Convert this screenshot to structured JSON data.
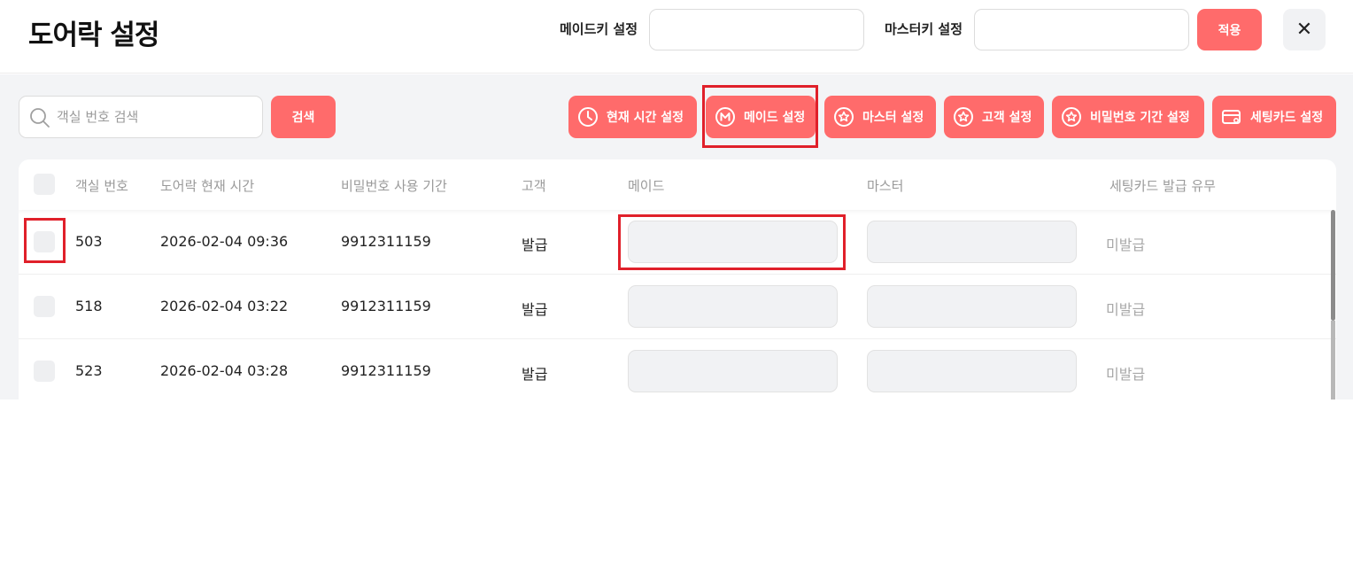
{
  "header": {
    "title": "도어락 설정",
    "maid_key_label": "메이드키 설정",
    "maid_key_value": "",
    "master_key_label": "마스터키 설정",
    "master_key_value": "",
    "apply_label": "적용",
    "close_symbol": "✕"
  },
  "toolbar": {
    "search_placeholder": "객실 번호 검색",
    "search_label": "검색",
    "actions": [
      {
        "label": "현재 시간 설정",
        "icon": "clock-icon"
      },
      {
        "label": "메이드 설정",
        "icon": "maid-m-icon"
      },
      {
        "label": "마스터 설정",
        "icon": "star-icon"
      },
      {
        "label": "고객 설정",
        "icon": "star-icon"
      },
      {
        "label": "비밀번호 기간 설정",
        "icon": "star-icon"
      },
      {
        "label": "세팅카드 설정",
        "icon": "card-icon"
      }
    ]
  },
  "table": {
    "columns": [
      "객실 번호",
      "도어락 현재 시간",
      "비밀번호 사용 기간",
      "고객",
      "메이드",
      "마스터",
      "세팅카드 발급 유무"
    ],
    "rows": [
      {
        "room": "503",
        "time": "2026-02-04 09:36",
        "period": "9912311159",
        "guest": "발급",
        "maid": "",
        "master": "",
        "card": "미발급"
      },
      {
        "room": "518",
        "time": "2026-02-04 03:22",
        "period": "9912311159",
        "guest": "발급",
        "maid": "",
        "master": "",
        "card": "미발급"
      },
      {
        "room": "523",
        "time": "2026-02-04 03:28",
        "period": "9912311159",
        "guest": "발급",
        "maid": "",
        "master": "",
        "card": "미발급"
      }
    ]
  },
  "colors": {
    "accent": "#ff6b6b",
    "highlight": "#e0202a",
    "content_bg": "#f3f4f6"
  }
}
